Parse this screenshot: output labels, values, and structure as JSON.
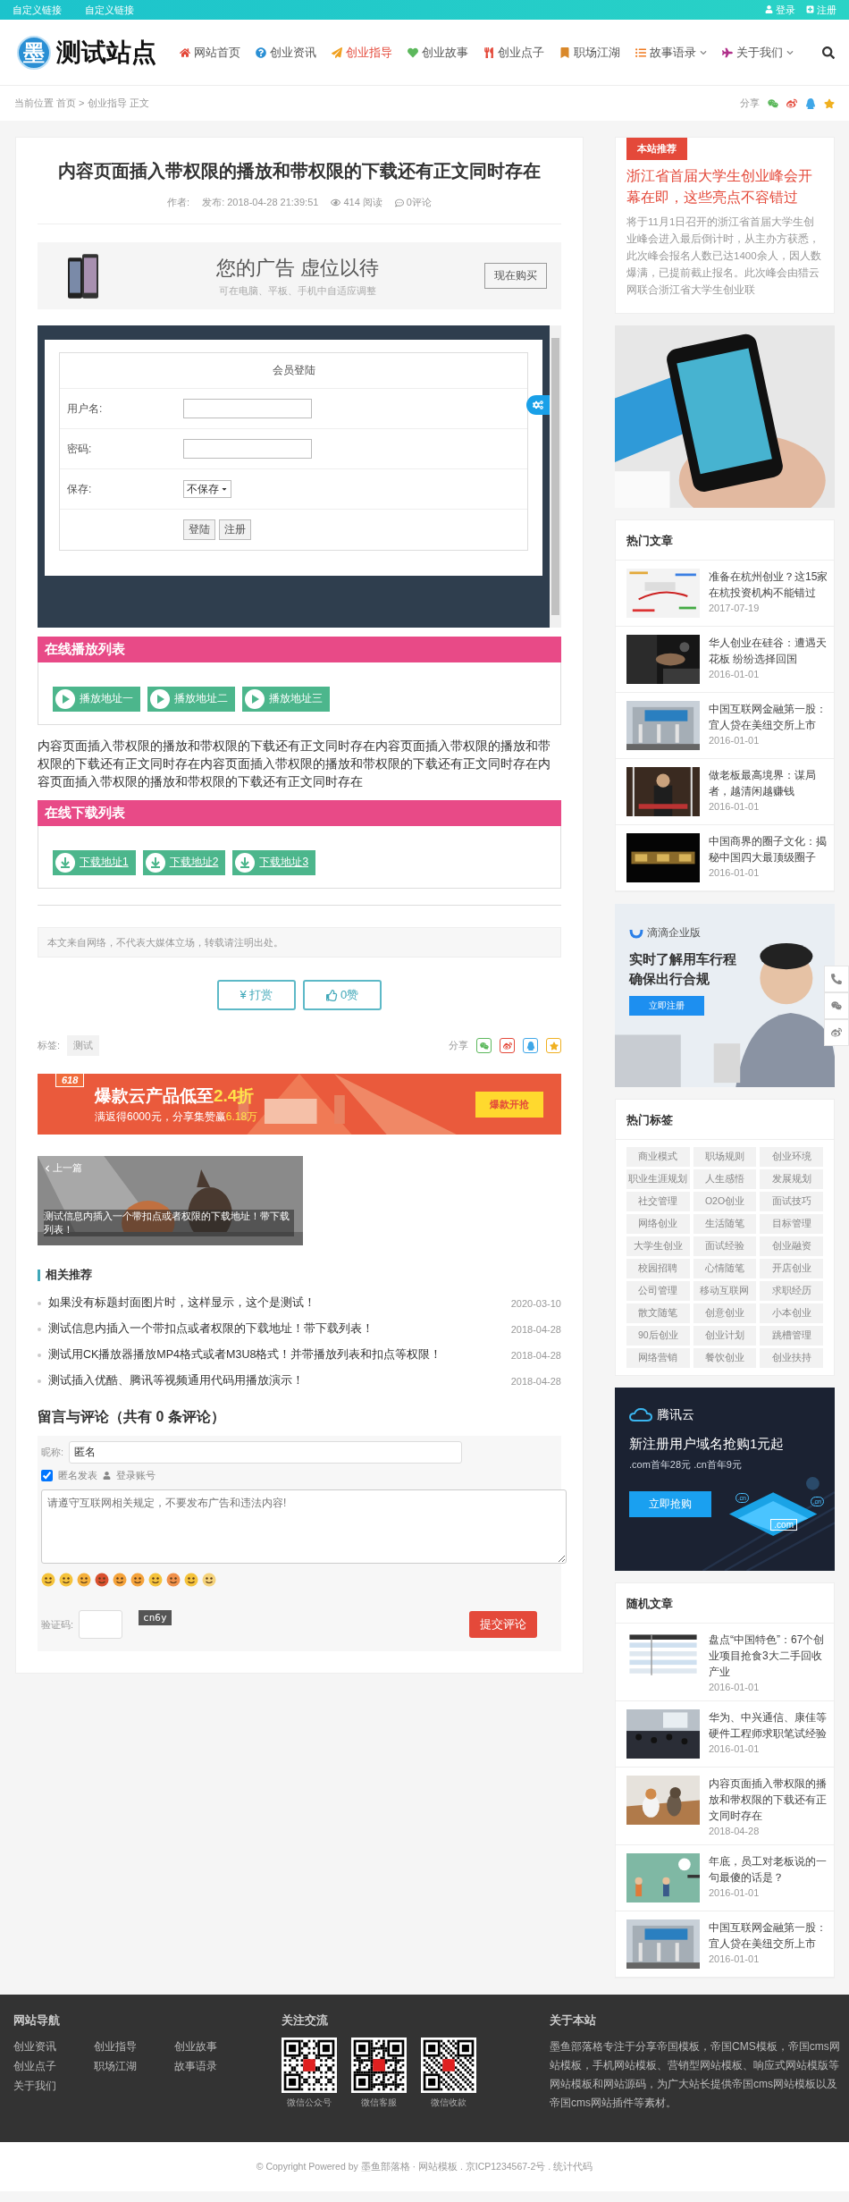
{
  "topbar": {
    "links": [
      "自定义链接",
      "自定义链接"
    ],
    "login": "登录",
    "register": "注册"
  },
  "logo": {
    "mark": "墨",
    "name": "测试站点"
  },
  "nav": [
    {
      "label": "网站首页",
      "kind": "home",
      "selected": false,
      "dropdown": false
    },
    {
      "label": "创业资讯",
      "kind": "question",
      "selected": false,
      "dropdown": false
    },
    {
      "label": "创业指导",
      "kind": "paper-plane",
      "selected": true,
      "dropdown": false
    },
    {
      "label": "创业故事",
      "kind": "heart",
      "selected": false,
      "dropdown": false
    },
    {
      "label": "创业点子",
      "kind": "utensils",
      "selected": false,
      "dropdown": false
    },
    {
      "label": "职场江湖",
      "kind": "bookmark",
      "selected": false,
      "dropdown": false
    },
    {
      "label": "故事语录",
      "kind": "list",
      "selected": false,
      "dropdown": true
    },
    {
      "label": "关于我们",
      "kind": "plane",
      "selected": false,
      "dropdown": true
    }
  ],
  "breadcrumb": {
    "text": "当前位置 首页 > 创业指导 正文",
    "share": "分享"
  },
  "article": {
    "title": "内容页面插入带权限的播放和带权限的下载还有正文同时存在",
    "meta": {
      "author": "作者:",
      "date": "发布: 2018-04-28 21:39:51",
      "views": "414 阅读",
      "comments": "0评论"
    },
    "ad": {
      "title": "您的广告 虚位以待",
      "subtitle": "可在电脑、平板、手机中自适应调整",
      "button": "现在购买"
    },
    "login_form": {
      "title": "会员登陆",
      "fields": [
        {
          "label": "用户名:",
          "kind": "text"
        },
        {
          "label": "密码:",
          "kind": "password"
        },
        {
          "label": "保存:",
          "kind": "select",
          "value": "不保存"
        }
      ],
      "buttons": [
        "登陆",
        "注册"
      ]
    },
    "play_list": {
      "title": "在线播放列表",
      "items": [
        "播放地址一",
        "播放地址二",
        "播放地址三"
      ]
    },
    "body": "内容页面插入带权限的播放和带权限的下载还有正文同时存在内容页面插入带权限的播放和带权限的下载还有正文同时存在内容页面插入带权限的播放和带权限的下载还有正文同时存在内容页面插入带权限的播放和带权限的下载还有正文同时存在",
    "download_list": {
      "title": "在线下载列表",
      "items": [
        "下载地址1",
        "下载地址2",
        "下载地址3"
      ]
    },
    "disclaimer": "本文来自网络，不代表大媒体立场，转载请注明出处。",
    "actions": [
      {
        "label": "¥ 打赏",
        "kind": "reward"
      },
      {
        "label": "0赞",
        "kind": "like"
      }
    ],
    "tags": {
      "label": "标签:",
      "items": [
        "测试"
      ]
    },
    "share": "分享",
    "promo": {
      "badge": "618",
      "headline": "爆款云产品低至",
      "headline_highlight": "2.4折",
      "subline": "满返得6000元，分享集赞赢",
      "subline_highlight": "6.18万",
      "button": "爆款开抢"
    },
    "prev_post": {
      "label": "上一篇",
      "title": "测试信息内插入一个带扣点或者权限的下载地址！带下载列表！"
    },
    "related": {
      "title": "相关推荐",
      "items": [
        {
          "title": "如果没有标题封面图片时，这样显示，这个是测试！",
          "date": "2020-03-10"
        },
        {
          "title": "测试信息内插入一个带扣点或者权限的下载地址！带下载列表！",
          "date": "2018-04-28"
        },
        {
          "title": "测试用CK播放器播放MP4格式或者M3U8格式！并带播放列表和扣点等权限！",
          "date": "2018-04-28"
        },
        {
          "title": "测试插入优酷、腾讯等视频通用代码用播放演示！",
          "date": "2018-04-28"
        }
      ]
    },
    "comments": {
      "title": "留言与评论（共有 0 条评论）",
      "nickname_label": "昵称:",
      "nickname": "匿名",
      "anonymous": {
        "label": "匿名发表",
        "checked": true
      },
      "login_link": "登录账号",
      "placeholder": "请遵守互联网相关规定，不要发布广告和违法内容!",
      "captcha_label": "验证码:",
      "captcha": "cn6y",
      "submit": "提交评论"
    }
  },
  "sidebar": {
    "recommend": {
      "badge": "本站推荐",
      "title": "浙江省首届大学生创业峰会开幕在即，这些亮点不容错过",
      "summary": "将于11月1日召开的浙江省首届大学生创业峰会进入最后倒计时，从主办方获悉，此次峰会报名人数已达1400余人，因人数爆满，已提前截止报名。此次峰会由猎云网联合浙江省大学生创业联"
    },
    "hot": {
      "title": "热门文章",
      "items": [
        {
          "title": "准备在杭州创业？这15家在杭投资机构不能错过",
          "date": "2017-07-19"
        },
        {
          "title": "华人创业在硅谷：遭遇天花板 纷纷选择回国",
          "date": "2016-01-01"
        },
        {
          "title": "中国互联网金融第一股：宜人贷在美纽交所上市",
          "date": "2016-01-01"
        },
        {
          "title": "做老板最高境界：谋局者，越清闲越赚钱",
          "date": "2016-01-01"
        },
        {
          "title": "中国商界的圈子文化：揭秘中国四大最顶级圈子",
          "date": "2016-01-01"
        }
      ]
    },
    "didi_ad": {
      "brand": "滴滴企业版",
      "headline": [
        "实时了解用车行程",
        "确保出行合规"
      ],
      "button": "立即注册"
    },
    "hot_tags": {
      "title": "热门标签",
      "items": [
        "商业模式",
        "职场规则",
        "创业环境",
        "职业生涯规划",
        "人生感悟",
        "发展规划",
        "社交管理",
        "O2O创业",
        "面试技巧",
        "网络创业",
        "生活随笔",
        "目标管理",
        "大学生创业",
        "面试经验",
        "创业融资",
        "校园招聘",
        "心情随笔",
        "开店创业",
        "公司管理",
        "移动互联网",
        "求职经历",
        "散文随笔",
        "创意创业",
        "小本创业",
        "90后创业",
        "创业计划",
        "跳槽管理",
        "网络营销",
        "餐饮创业",
        "创业扶持"
      ]
    },
    "tencent_ad": {
      "brand": "腾讯云",
      "headline": "新注册用户域名抢购1元起",
      "subline": ".com首年28元 .cn首年9元",
      "button": "立即抢购",
      "screen": ".com",
      "badges": [
        ".cn",
        ".cn"
      ]
    },
    "random": {
      "title": "随机文章",
      "items": [
        {
          "title": "盘点“中国特色”：67个创业项目抢食3大二手回收产业",
          "date": "2016-01-01"
        },
        {
          "title": "华为、中兴通信、康佳等硬件工程师求职笔试经验",
          "date": "2016-01-01"
        },
        {
          "title": "内容页面插入带权限的播放和带权限的下载还有正文同时存在",
          "date": "2018-04-28"
        },
        {
          "title": "年底，员工对老板说的一句最傻的话是？",
          "date": "2016-01-01"
        },
        {
          "title": "中国互联网金融第一股：宜人贷在美纽交所上市",
          "date": "2016-01-01"
        }
      ]
    }
  },
  "footer": {
    "nav": {
      "title": "网站导航",
      "links": [
        "创业资讯",
        "创业指导",
        "创业故事",
        "创业点子",
        "职场江湖",
        "故事语录",
        "关于我们"
      ]
    },
    "follow": {
      "title": "关注交流",
      "codes": [
        "微信公众号",
        "微信客服",
        "微信收款"
      ]
    },
    "about": {
      "title": "关于本站",
      "text": "墨鱼部落格专注于分享帝国模板，帝国CMS模板，帝国cms网站模板，手机网站模板、营销型网站模板、响应式网站模版等网站模板和网站源码，为广大站长提供帝国cms网站模板以及帝国cms网站插件等素材。"
    },
    "copyright": "© Copyright Powered by 墨鱼部落格 · 网站模板 . 京ICP1234567-2号 . 统计代码"
  }
}
